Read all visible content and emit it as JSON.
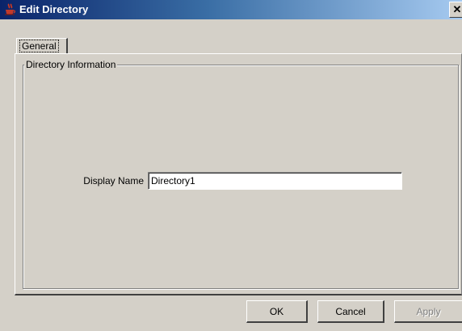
{
  "window": {
    "title": "Edit Directory",
    "icon": "java-coffee-cup-icon",
    "close_glyph": "✕"
  },
  "tabs": [
    {
      "label": "General",
      "selected": true
    }
  ],
  "group": {
    "legend": "Directory Information"
  },
  "form": {
    "display_name_label": "Display Name",
    "display_name_value": "Directory1"
  },
  "buttons": {
    "ok": "OK",
    "cancel": "Cancel",
    "apply": "Apply",
    "apply_enabled": false
  },
  "colors": {
    "title_gradient_start": "#0a246a",
    "title_gradient_end": "#a6caf0",
    "dialog_background": "#d4d0c8"
  }
}
